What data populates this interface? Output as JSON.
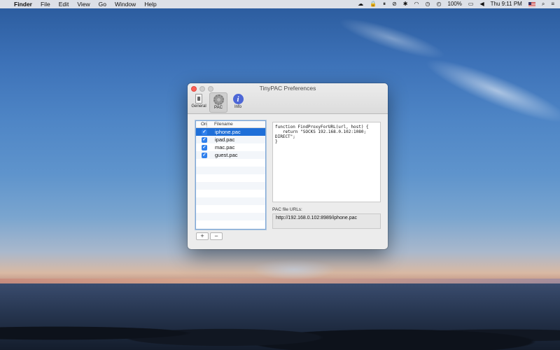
{
  "menubar": {
    "app_name": "Finder",
    "menus": [
      "File",
      "Edit",
      "View",
      "Go",
      "Window",
      "Help"
    ],
    "battery": "100%",
    "clock": "Thu 9:11 PM"
  },
  "window": {
    "title": "TinyPAC Preferences",
    "toolbar": {
      "general_label": "General",
      "pac_label": "PAC",
      "info_label": "Info",
      "active": "PAC"
    },
    "list": {
      "col_on": "On",
      "col_filename": "Filename",
      "files": [
        {
          "name": "iphone.pac",
          "checked": true,
          "selected": true
        },
        {
          "name": "ipad.pac",
          "checked": true,
          "selected": false
        },
        {
          "name": "mac.pac",
          "checked": true,
          "selected": false
        },
        {
          "name": "guest.pac",
          "checked": true,
          "selected": false
        }
      ],
      "add_label": "+",
      "remove_label": "−"
    },
    "code": "function FindProxyForURL(url, host) {\n   return \"SOCKS 192.168.0.102:1080; DIRECT\";\n}",
    "urls_label": "PAC file URLs:",
    "url_value": "http://192.168.0.102:8989/iphone.pac"
  },
  "colors": {
    "selection": "#1f6fd8",
    "checkbox": "#2f80ed",
    "close_button": "#fc5f57"
  }
}
